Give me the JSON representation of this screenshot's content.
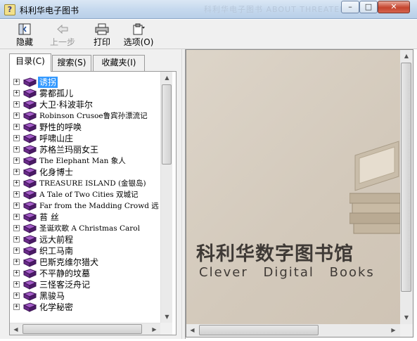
{
  "window": {
    "title": "科利华电子图书",
    "ghost_title": "科利华电子图书 ABOUT THREATENING",
    "controls": {
      "minimize": "–",
      "maximize": "□",
      "close": "✕"
    }
  },
  "toolbar": {
    "hide_label": "隐藏",
    "back_label": "上一步",
    "print_label": "打印",
    "options_label": "选项(O)"
  },
  "tabs": {
    "toc": "目录(C)",
    "search": "搜索(S)",
    "favorites": "收藏夹(I)"
  },
  "tree": {
    "items": [
      {
        "label": "诱拐",
        "selected": true,
        "latin": false
      },
      {
        "label": "雾都孤儿",
        "selected": false,
        "latin": false
      },
      {
        "label": "大卫·科波菲尔",
        "selected": false,
        "latin": false
      },
      {
        "label": "Robinson Crusoe鲁宾孙漂流记",
        "selected": false,
        "latin": true
      },
      {
        "label": "野性的呼唤",
        "selected": false,
        "latin": false
      },
      {
        "label": "呼啸山庄",
        "selected": false,
        "latin": false
      },
      {
        "label": "苏格兰玛丽女王",
        "selected": false,
        "latin": false
      },
      {
        "label": "The Elephant Man 象人",
        "selected": false,
        "latin": true
      },
      {
        "label": "化身博士",
        "selected": false,
        "latin": false
      },
      {
        "label": "TREASURE ISLAND (金银岛)",
        "selected": false,
        "latin": true
      },
      {
        "label": "A Tale of Two Cities 双城记",
        "selected": false,
        "latin": true
      },
      {
        "label": "Far from the Madding Crowd 远",
        "selected": false,
        "latin": true
      },
      {
        "label": "苔 丝",
        "selected": false,
        "latin": false
      },
      {
        "label": "圣诞欢歌 A Christmas Carol",
        "selected": false,
        "latin": true
      },
      {
        "label": "远大前程",
        "selected": false,
        "latin": false
      },
      {
        "label": "织工马南",
        "selected": false,
        "latin": false
      },
      {
        "label": "巴斯克维尔猎犬",
        "selected": false,
        "latin": false
      },
      {
        "label": "不平静的坟墓",
        "selected": false,
        "latin": false
      },
      {
        "label": "三怪客泛舟记",
        "selected": false,
        "latin": false
      },
      {
        "label": "黑骏马",
        "selected": false,
        "latin": false
      },
      {
        "label": "化学秘密",
        "selected": false,
        "latin": false
      }
    ]
  },
  "brand": {
    "chinese": "科利华数字图书馆",
    "english": "Clever Digital Books"
  },
  "colors": {
    "selection": "#3399ff",
    "book_icon": "#6a2a8a",
    "content_bg": "#d8cfc2",
    "brand_text": "#3f3a36"
  }
}
